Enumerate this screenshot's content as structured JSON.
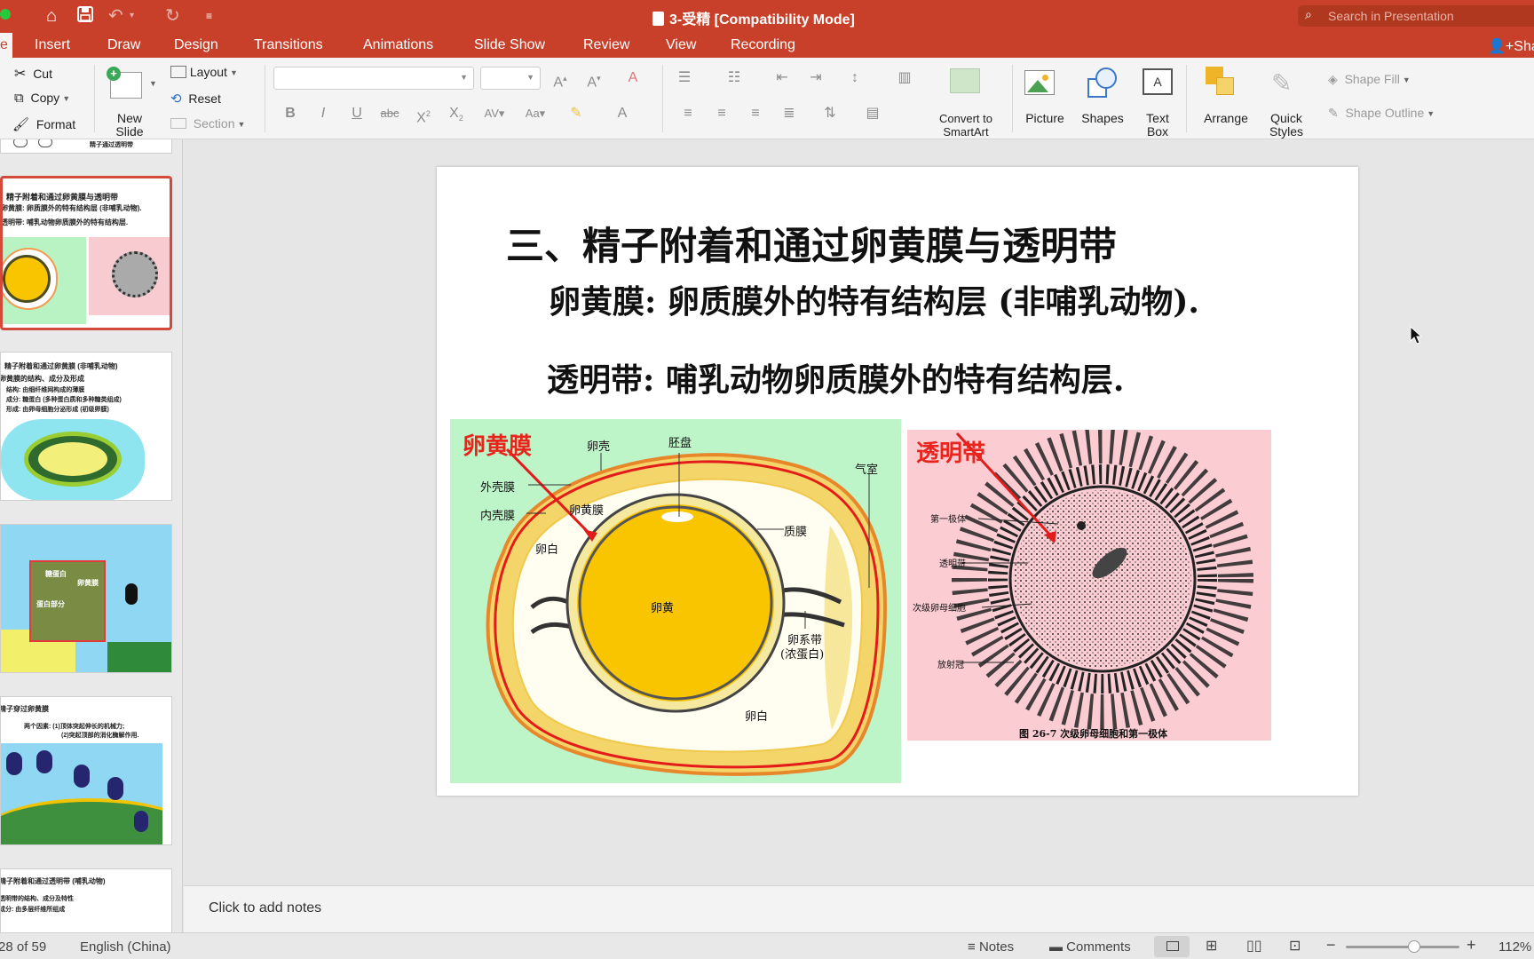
{
  "window": {
    "title": "3-受精 [Compatibility Mode]",
    "search_placeholder": "Search in Presentation",
    "share_label": "Sha"
  },
  "ribbon_tabs": [
    {
      "label": "e",
      "active": true
    },
    {
      "label": "Insert"
    },
    {
      "label": "Draw"
    },
    {
      "label": "Design"
    },
    {
      "label": "Transitions"
    },
    {
      "label": "Animations"
    },
    {
      "label": "Slide Show"
    },
    {
      "label": "Review"
    },
    {
      "label": "View"
    },
    {
      "label": "Recording"
    }
  ],
  "ribbon": {
    "clipboard": {
      "cut": "Cut",
      "copy": "Copy",
      "format": "Format"
    },
    "new_slide": "New Slide",
    "slides": {
      "layout": "Layout",
      "reset": "Reset",
      "section": "Section"
    },
    "convert_smartart": "Convert to SmartArt",
    "picture": "Picture",
    "shapes": "Shapes",
    "text_box": "Text Box",
    "arrange": "Arrange",
    "quick_styles": "Quick Styles",
    "shape_fill": "Shape Fill",
    "shape_outline": "Shape Outline"
  },
  "thumbnails": [
    {
      "lines": [
        "精子附着和通过卵黄膜与透明带",
        "卵黄膜: 卵质膜外的特有结构层 (非哺乳动物).",
        "透明带: 哺乳动物卵质膜外的特有结构层."
      ],
      "selected": true
    },
    {
      "lines": [
        "精子附着和通过卵黄膜 (非哺乳动物)",
        "卵黄膜的结构、成分及形成",
        "结构: 由细纤维网构成的薄膜",
        "成分: 糖蛋白 (多种蛋白质和多种糖类组成)",
        "形成: 由卵母细胞分泌形成 (初级卵膜)"
      ]
    },
    {
      "lines": [
        "卵黄膜",
        "糖蛋白",
        "蛋白部分"
      ]
    },
    {
      "lines": [
        "精子穿过卵黄膜",
        "两个因素: (1)顶体突起伸长的机械力;",
        "(2)突起顶部的消化酶解作用."
      ]
    },
    {
      "lines": [
        "精子附着和通过透明带 (哺乳动物)",
        "透明带的结构、成分及特性",
        "成分: 由多层纤维所组成"
      ]
    }
  ],
  "slide": {
    "title": "三、精子附着和通过卵黄膜与透明带",
    "line1": "卵黄膜: 卵质膜外的特有结构层 (非哺乳动物).",
    "line2": "透明带: 哺乳动物卵质膜外的特有结构层.",
    "egg_figure": {
      "red_label": "卵黄膜",
      "labels": {
        "shell": "卵壳",
        "disc": "胚盘",
        "air": "气室",
        "outer_membrane": "外壳膜",
        "inner_membrane": "内壳膜",
        "vitelline": "卵黄膜",
        "albumen_top": "卵白",
        "plasma_membrane": "质膜",
        "yolk": "卵黄",
        "chalaza": "卵系带",
        "chalaza_note": "(浓蛋白)",
        "albumen_bottom": "卵白"
      }
    },
    "zona_figure": {
      "red_label": "透明带",
      "labels": {
        "polar_body": "第一极体",
        "zona": "透明带",
        "oocyte": "次级卵母细胞",
        "corona": "放射冠"
      },
      "caption": "图 26-7  次级卵母细胞和第一极体"
    }
  },
  "notes_placeholder": "Click to add notes",
  "status": {
    "slide_position": "28 of 59",
    "language": "English (China)",
    "notes": "Notes",
    "comments": "Comments",
    "zoom": "112%",
    "zoom_level": 0.6
  }
}
